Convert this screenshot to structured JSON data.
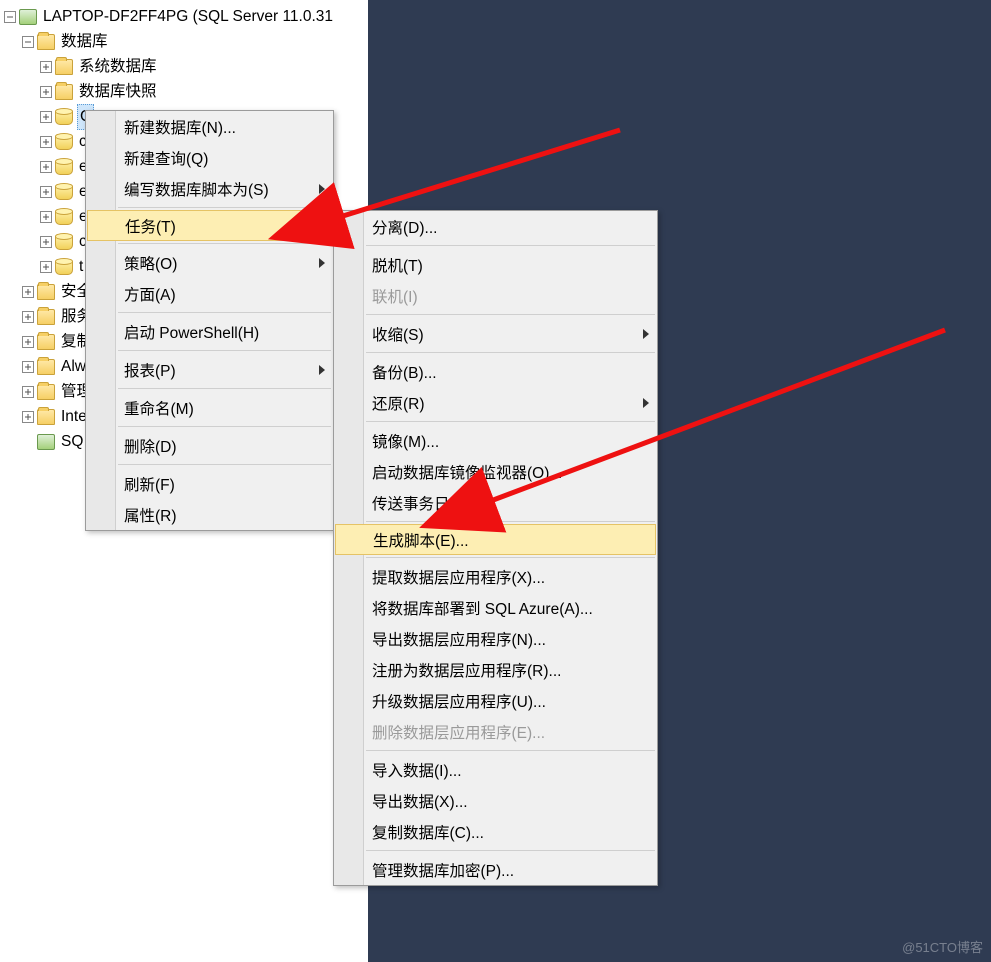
{
  "watermark": "@51CTO博客",
  "tree": {
    "server": "LAPTOP-DF2FF4PG (SQL Server 11.0.31",
    "databases": "数据库",
    "sysdb": "系统数据库",
    "snapshot": "数据库快照",
    "db_items": [
      "C",
      "c",
      "e",
      "e",
      "e",
      "c",
      "t"
    ],
    "security": "安全",
    "server_obj": "服务",
    "replication": "复制",
    "alwayson": "Alw",
    "management": "管理",
    "integration": "Inte",
    "sqlagent": "SQ"
  },
  "menu1": {
    "newdb": "新建数据库(N)...",
    "newquery": "新建查询(Q)",
    "script": "编写数据库脚本为(S)",
    "tasks": "任务(T)",
    "policy": "策略(O)",
    "facets": "方面(A)",
    "powershell": "启动 PowerShell(H)",
    "reports": "报表(P)",
    "rename": "重命名(M)",
    "delete": "删除(D)",
    "refresh": "刷新(F)",
    "properties": "属性(R)"
  },
  "menu2": {
    "detach": "分离(D)...",
    "offline": "脱机(T)",
    "online": "联机(I)",
    "shrink": "收缩(S)",
    "backup": "备份(B)...",
    "restore": "还原(R)",
    "mirror": "镜像(M)...",
    "mirror_monitor": "启动数据库镜像监视器(O)...",
    "ship_log": "传送事务日志(L)...",
    "gen_script": "生成脚本(E)...",
    "extract_dtap": "提取数据层应用程序(X)...",
    "deploy_azure": "将数据库部署到 SQL Azure(A)...",
    "export_dtap": "导出数据层应用程序(N)...",
    "register_dtap": "注册为数据层应用程序(R)...",
    "upgrade_dtap": "升级数据层应用程序(U)...",
    "delete_dtap": "删除数据层应用程序(E)...",
    "import_data": "导入数据(I)...",
    "export_data": "导出数据(X)...",
    "copy_db": "复制数据库(C)...",
    "encrypt": "管理数据库加密(P)..."
  }
}
